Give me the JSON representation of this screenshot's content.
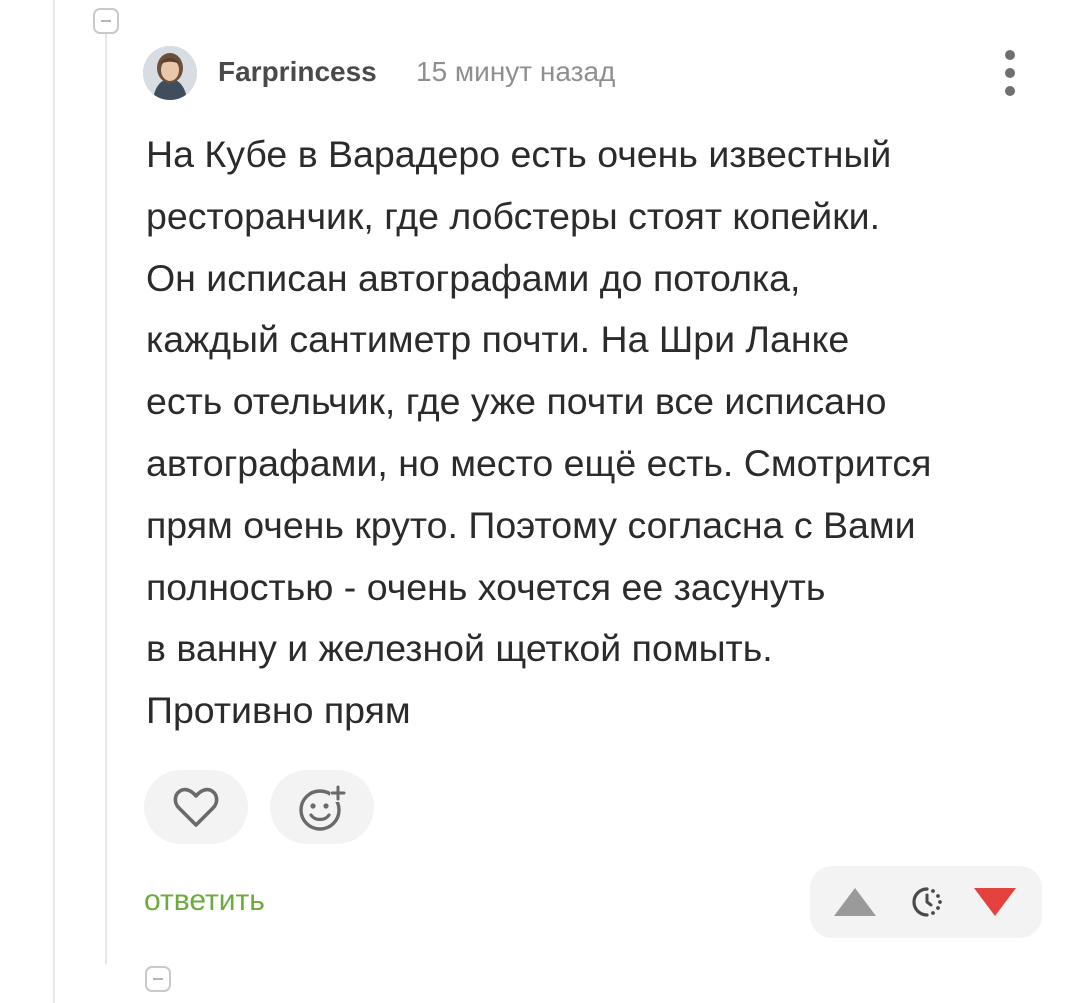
{
  "comment": {
    "author": "Farprincess",
    "timestamp": "15 минут назад",
    "text": "На Кубе в Варадеро есть очень известный\nресторанчик, где лобстеры стоят копейки.\nОн исписан автографами до потолка,\nкаждый сантиметр почти. На Шри Ланке\nесть отельчик, где уже почти все исписано\nавтографами, но место ещё есть. Смотрится\nпрям очень круто. Поэтому согласна с Вами\nполностью - очень хочется ее засунуть\nв ванну и железной щеткой помыть.\nПротивно прям"
  },
  "reactions": {
    "like_icon": "heart-icon",
    "emoji_icon": "add-emoji-icon"
  },
  "actions": {
    "reply_label": "ответить"
  },
  "rating": {
    "upvote_icon": "triangle-up-icon",
    "score_icon": "clock-loading-icon",
    "downvote_icon": "triangle-down-icon"
  },
  "colors": {
    "reply_link": "#6cab3e",
    "downvote": "#e4423f",
    "upvote": "#9a9a9a"
  }
}
